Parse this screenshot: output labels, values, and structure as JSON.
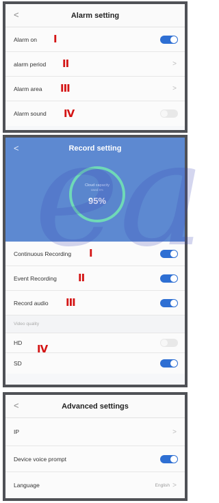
{
  "alarm": {
    "title": "Alarm setting",
    "back": "<",
    "rows": [
      {
        "label": "Alarm on",
        "marker": "I"
      },
      {
        "label": "alarm period",
        "marker": "II",
        "arrow": ">"
      },
      {
        "label": "Alarm area",
        "marker": "III",
        "arrow": ">"
      },
      {
        "label": "Alarm sound",
        "marker": "IV"
      }
    ]
  },
  "record": {
    "title": "Record setting",
    "back": "<",
    "ring_sub": "Cloud capacity",
    "ring_sub2": "Used 5%",
    "ring_pct": "95%",
    "rows": [
      {
        "label": "Continuous Recording",
        "marker": "I"
      },
      {
        "label": "Event Recording",
        "marker": "II"
      },
      {
        "label": "Record audio",
        "marker": "III"
      }
    ],
    "section": "Video quality",
    "quality": [
      {
        "label": "HD"
      },
      {
        "label": "SD"
      }
    ],
    "quality_marker": "IV"
  },
  "advanced": {
    "title": "Advanced settings",
    "back": "<",
    "rows": [
      {
        "label": "IP",
        "arrow": ">"
      },
      {
        "label": "Device voice prompt"
      },
      {
        "label": "Language",
        "value": "English",
        "arrow": ">"
      }
    ]
  },
  "toggles": {
    "alarm_on": true,
    "alarm_sound": false,
    "continuous": true,
    "event": true,
    "audio": true,
    "hd": false,
    "sd": true,
    "voice_prompt": true
  },
  "watermark": "ea",
  "colors": {
    "accent": "#2e6fd3",
    "marker": "#d41414",
    "header_blue": "#5d89d1",
    "ring": "#6fd9b7",
    "frame": "#4f5156"
  }
}
